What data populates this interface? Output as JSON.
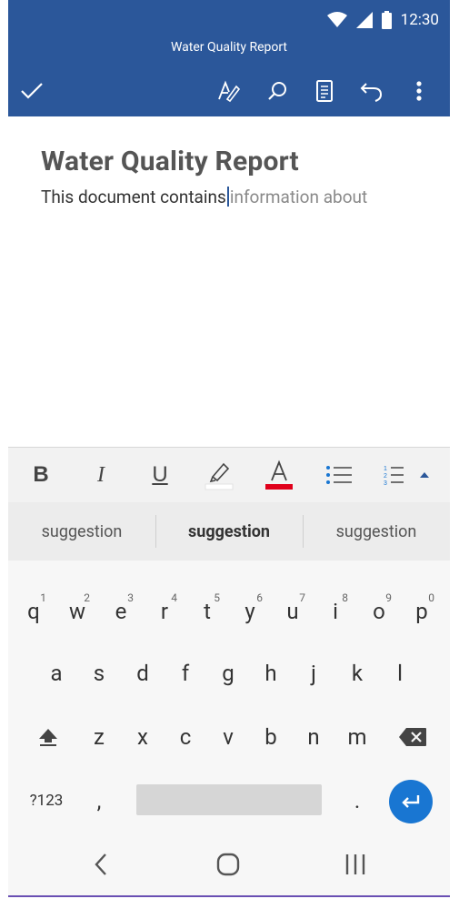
{
  "status_bar": {
    "time": "12:30",
    "icons": [
      "wifi-icon",
      "signal-icon",
      "battery-icon"
    ]
  },
  "header": {
    "title": "Water Quality Report",
    "toolbar": [
      "checkmark-icon",
      "draw-pen-icon",
      "search-icon",
      "reading-view-icon",
      "undo-icon",
      "more-vertical-icon"
    ]
  },
  "document": {
    "heading": "Water Quality Report",
    "typed_text": "This document contains",
    "predicted_text": "information about"
  },
  "format_bar": {
    "bold": "B",
    "italic": "I",
    "underline": "U",
    "highlight_color": "#ffffff",
    "font_color": "#e0001b",
    "font_color_label": "A"
  },
  "suggestions": [
    "suggestion",
    "suggestion",
    "suggestion"
  ],
  "keyboard": {
    "row1": [
      "q",
      "w",
      "e",
      "r",
      "t",
      "y",
      "u",
      "i",
      "o",
      "p"
    ],
    "row1_hints": [
      "1",
      "2",
      "3",
      "4",
      "5",
      "6",
      "7",
      "8",
      "9",
      "0"
    ],
    "row2": [
      "a",
      "s",
      "d",
      "f",
      "g",
      "h",
      "j",
      "k",
      "l"
    ],
    "row3": [
      "z",
      "x",
      "c",
      "v",
      "b",
      "n",
      "m"
    ],
    "symbols_key": "?123",
    "comma": ",",
    "period": ".",
    "accent_color": "#1976d2"
  },
  "colors": {
    "app_bar": "#2b579a"
  }
}
